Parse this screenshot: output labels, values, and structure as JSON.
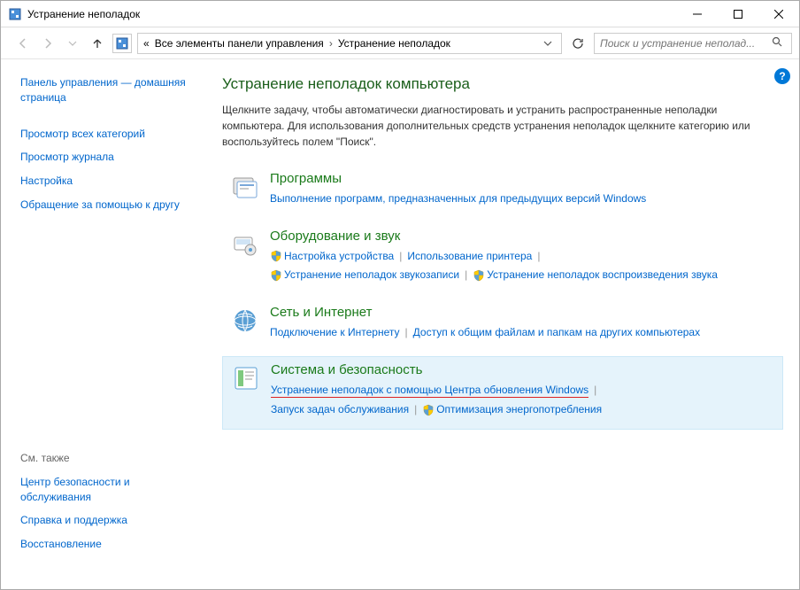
{
  "window": {
    "title": "Устранение неполадок"
  },
  "breadcrumb": {
    "prefix": "«",
    "part1": "Все элементы панели управления",
    "part2": "Устранение неполадок"
  },
  "search": {
    "placeholder": "Поиск и устранение неполад..."
  },
  "sidebar": {
    "home": "Панель управления — домашняя страница",
    "links": [
      "Просмотр всех категорий",
      "Просмотр журнала",
      "Настройка",
      "Обращение за помощью к другу"
    ],
    "see_also_heading": "См. также",
    "see_also": [
      "Центр безопасности и обслуживания",
      "Справка и поддержка",
      "Восстановление"
    ]
  },
  "main": {
    "title": "Устранение неполадок компьютера",
    "description": "Щелкните задачу, чтобы автоматически диагностировать и устранить распространенные неполадки компьютера. Для использования дополнительных средств устранения неполадок щелкните категорию или воспользуйтесь полем \"Поиск\"."
  },
  "categories": [
    {
      "title": "Программы",
      "links": [
        {
          "label": "Выполнение программ, предназначенных для предыдущих версий Windows",
          "shield": false
        }
      ]
    },
    {
      "title": "Оборудование и звук",
      "links": [
        {
          "label": "Настройка устройства",
          "shield": true
        },
        {
          "label": "Использование принтера",
          "shield": false
        },
        {
          "label": "Устранение неполадок звукозаписи",
          "shield": true
        },
        {
          "label": "Устранение неполадок воспроизведения звука",
          "shield": true
        }
      ]
    },
    {
      "title": "Сеть и Интернет",
      "links": [
        {
          "label": "Подключение к Интернету",
          "shield": false
        },
        {
          "label": "Доступ к общим файлам и папкам на других компьютерах",
          "shield": false
        }
      ]
    },
    {
      "title": "Система и безопасность",
      "highlighted": true,
      "links": [
        {
          "label": "Устранение неполадок с помощью Центра обновления Windows",
          "shield": false,
          "underlined": true
        },
        {
          "label": "Запуск задач обслуживания",
          "shield": false
        },
        {
          "label": "Оптимизация энергопотребления",
          "shield": true
        }
      ]
    }
  ]
}
